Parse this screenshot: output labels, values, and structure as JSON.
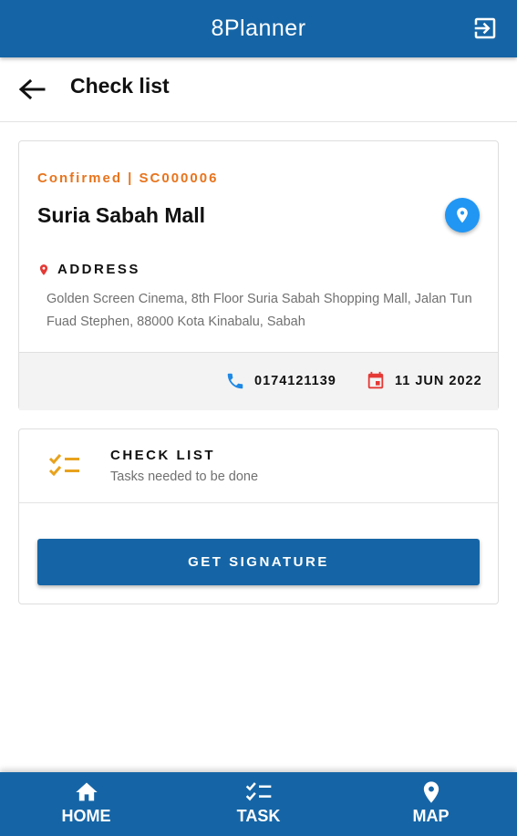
{
  "app": {
    "title": "8Planner"
  },
  "header": {
    "title": "Check list"
  },
  "job": {
    "status_line": "Confirmed | SC000006",
    "venue": "Suria Sabah Mall",
    "address_label": "ADDRESS",
    "address": "Golden Screen Cinema, 8th Floor Suria Sabah Shopping Mall, Jalan Tun Fuad Stephen, 88000 Kota Kinabalu, Sabah",
    "phone": "0174121139",
    "date": "11 JUN 2022"
  },
  "checklist": {
    "title": "CHECK LIST",
    "subtitle": "Tasks needed to be done",
    "signature_button": "GET SIGNATURE"
  },
  "nav": {
    "items": [
      {
        "label": "HOME",
        "icon": "home-icon"
      },
      {
        "label": "TASK",
        "icon": "checklist-icon"
      },
      {
        "label": "MAP",
        "icon": "map-pin-icon"
      }
    ]
  },
  "colors": {
    "primary": "#1565a6",
    "accent_orange": "#e8741d",
    "location_blue": "#2196f3",
    "calendar_red": "#e53935"
  }
}
